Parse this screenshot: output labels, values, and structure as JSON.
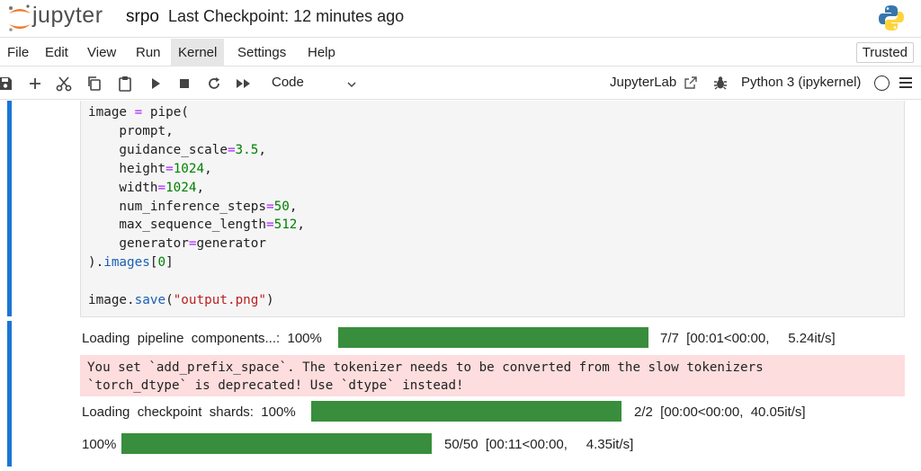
{
  "header": {
    "logo_text": "jupyter",
    "notebook_name": "srpo",
    "checkpoint": "Last Checkpoint: 12 minutes ago"
  },
  "menu": {
    "items": [
      "File",
      "Edit",
      "View",
      "Run",
      "Kernel",
      "Settings",
      "Help"
    ],
    "active": "Kernel",
    "trusted": "Trusted"
  },
  "toolbar": {
    "cell_type": "Code",
    "jupyterlab": "JupyterLab",
    "kernel": "Python 3 (ipykernel)"
  },
  "code_cell": {
    "lines": [
      "image = pipe(",
      "    prompt,",
      "    guidance_scale=3.5,",
      "    height=1024,",
      "    width=1024,",
      "    num_inference_steps=50,",
      "    max_sequence_length=512,",
      "    generator=generator",
      ").images[0]",
      "",
      "image.save(\"output.png\")"
    ]
  },
  "outputs": {
    "progress1": {
      "label": "Loading  pipeline  components...:  100%",
      "stats": "7/7  [00:01<00:00,     5.24it/s]",
      "fraction": 1.0
    },
    "stderr": [
      "You set `add_prefix_space`. The tokenizer needs to be converted from the slow tokenizers",
      "`torch_dtype` is deprecated! Use `dtype` instead!"
    ],
    "progress2": {
      "label": "Loading  checkpoint  shards:  100%",
      "stats": "2/2  [00:00<00:00,  40.05it/s]",
      "fraction": 1.0
    },
    "progress3": {
      "label": "100%",
      "stats": "50/50  [00:11<00:00,     4.35it/s]",
      "fraction": 1.0
    }
  },
  "colors": {
    "accent": "#1976d2",
    "progress_fill": "#388e3c",
    "stderr_bg": "#fddddd"
  }
}
